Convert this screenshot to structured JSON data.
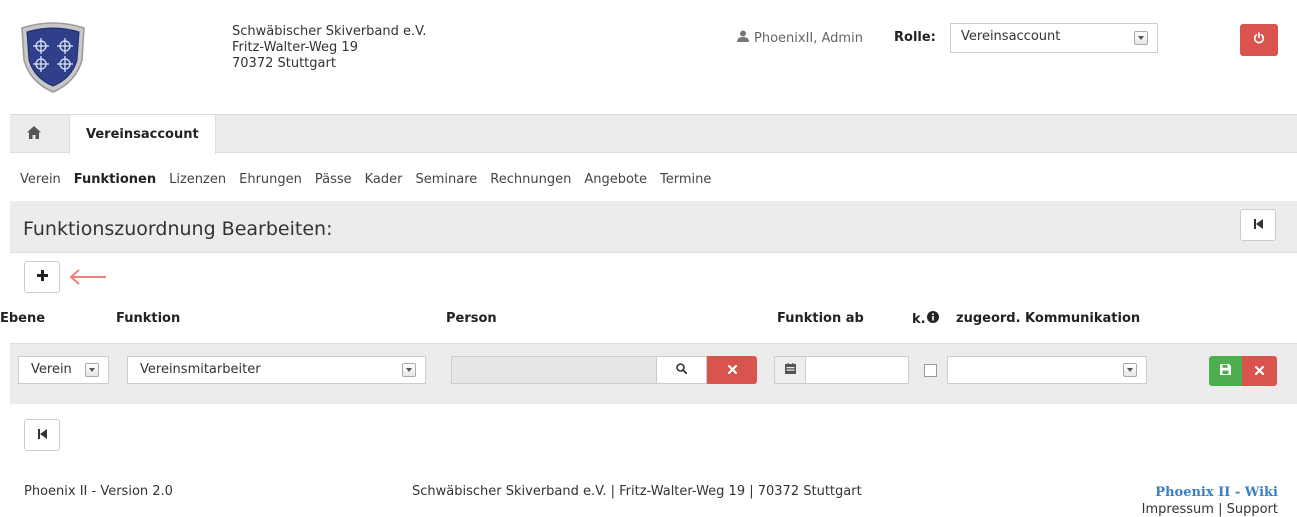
{
  "header": {
    "org_name": "Schwäbischer Skiverband e.V.",
    "org_street": "Fritz-Walter-Weg 19",
    "org_city": "70372 Stuttgart",
    "user_name": "PhoenixII, Admin",
    "role_label": "Rolle:",
    "role_value": "Vereinsaccount",
    "logo_icon": "ssv-shield-logo",
    "user_icon": "user-icon",
    "logout_icon": "power-icon"
  },
  "tabs": {
    "home_icon": "home-icon",
    "active_tab": "Vereinsaccount"
  },
  "subnav": [
    {
      "label": "Verein",
      "active": false
    },
    {
      "label": "Funktionen",
      "active": true
    },
    {
      "label": "Lizenzen",
      "active": false
    },
    {
      "label": "Ehrungen",
      "active": false
    },
    {
      "label": "Pässe",
      "active": false
    },
    {
      "label": "Kader",
      "active": false
    },
    {
      "label": "Seminare",
      "active": false
    },
    {
      "label": "Rechnungen",
      "active": false
    },
    {
      "label": "Angebote",
      "active": false
    },
    {
      "label": "Termine",
      "active": false
    }
  ],
  "panel": {
    "title": "Funktionszuordnung Bearbeiten:"
  },
  "columns": {
    "ebene": "Ebene",
    "funktion": "Funktion",
    "person": "Person",
    "funktion_ab": "Funktion ab",
    "k": "k.",
    "kommunikation": "zugeord. Kommunikation"
  },
  "row": {
    "ebene_value": "Verein",
    "funktion_value": "Vereinsmitarbeiter",
    "person_value": "",
    "funktion_ab_value": "",
    "k_checked": false,
    "kommunikation_value": ""
  },
  "footer": {
    "version": "Phoenix II - Version 2.0",
    "address": "Schwäbischer Skiverband e.V. | Fritz-Walter-Weg 19 | 70372 Stuttgart",
    "wiki": "Phoenix II - Wiki",
    "impressum": "Impressum",
    "separator": "|",
    "support": "Support"
  },
  "colors": {
    "danger": "#d9534f",
    "success": "#4cae4c",
    "link": "#3a7fc1",
    "annotation_arrow": "#e8837c"
  }
}
